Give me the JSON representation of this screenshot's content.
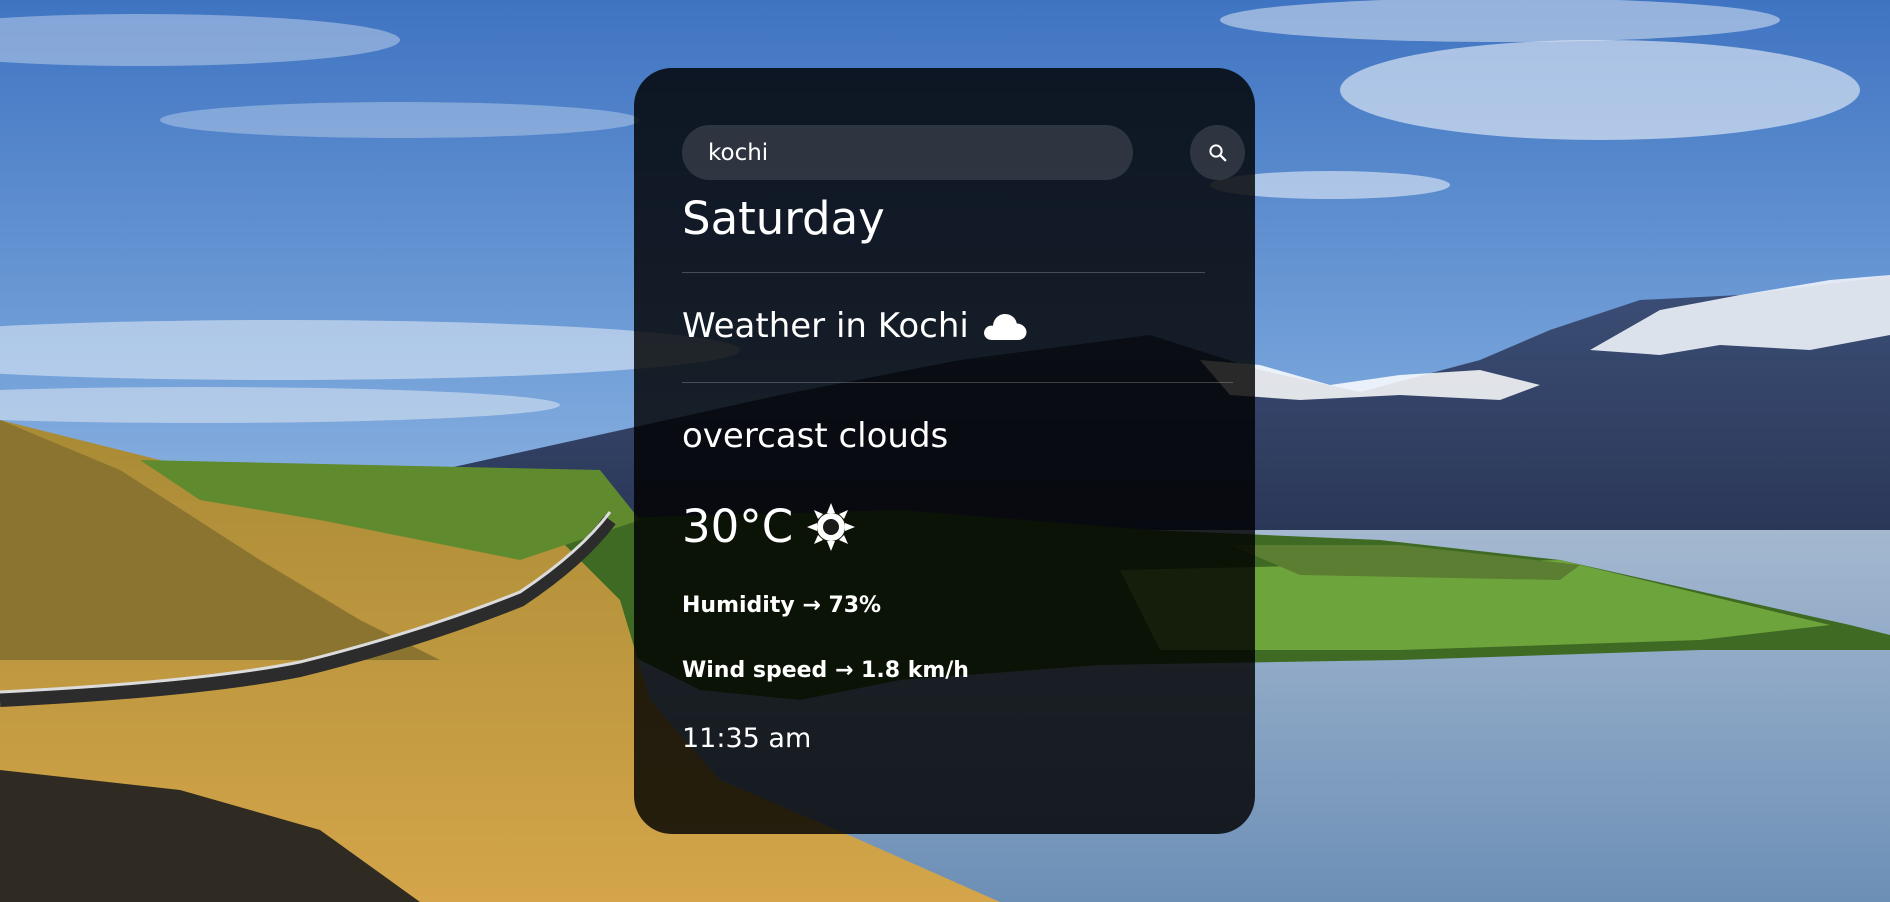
{
  "search": {
    "value": "kochi",
    "placeholder": "",
    "button_icon": "search-icon"
  },
  "weather": {
    "day": "Saturday",
    "location": "Weather in Kochi",
    "condition_icon": "cloud-icon",
    "description": "overcast clouds",
    "temperature": "30°C",
    "temperature_icon": "sun-icon",
    "humidity": "Humidity → 73%",
    "wind": "Wind speed → 1.8 km/h",
    "time": "11:35 am"
  },
  "colors": {
    "card_background": "#000000",
    "text": "#ffffff",
    "sky": "#5d8fcf",
    "water": "#7f9cbd",
    "grass": "#c49a38"
  }
}
